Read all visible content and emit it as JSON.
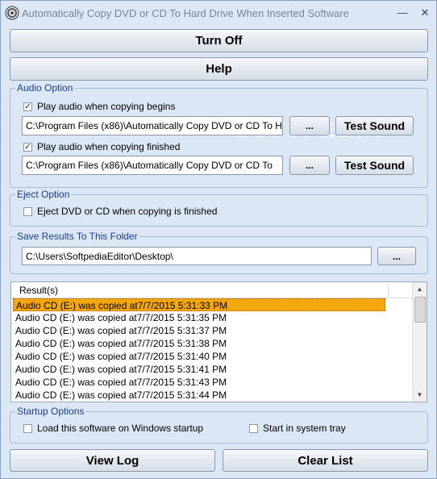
{
  "window": {
    "title": "Automatically Copy DVD or CD To Hard Drive When Inserted Software",
    "minimize": "—",
    "close": "✕"
  },
  "buttons": {
    "turn_off": "Turn Off",
    "help": "Help",
    "browse": "...",
    "test_sound": "Test Sound",
    "view_log": "View Log",
    "clear_list": "Clear List"
  },
  "audio_option": {
    "legend": "Audio Option",
    "begin_check_label": "Play audio when copying begins",
    "begin_checked": true,
    "begin_path": "C:\\Program Files (x86)\\Automatically Copy DVD or CD To H",
    "finish_check_label": "Play audio when copying finished",
    "finish_checked": true,
    "finish_path": "C:\\Program Files (x86)\\Automatically Copy DVD or CD To"
  },
  "eject_option": {
    "legend": "Eject Option",
    "check_label": "Eject DVD or CD when copying is finished",
    "checked": false
  },
  "save_results": {
    "legend": "Save Results To This Folder",
    "path": "C:\\Users\\SoftpediaEditor\\Desktop\\"
  },
  "results": {
    "header": "Result(s)",
    "rows": [
      "Audio CD (E:) was copied at7/7/2015 5:31:33 PM",
      "Audio CD (E:) was copied at7/7/2015 5:31:35 PM",
      "Audio CD (E:) was copied at7/7/2015 5:31:37 PM",
      "Audio CD (E:) was copied at7/7/2015 5:31:38 PM",
      "Audio CD (E:) was copied at7/7/2015 5:31:40 PM",
      "Audio CD (E:) was copied at7/7/2015 5:31:41 PM",
      "Audio CD (E:) was copied at7/7/2015 5:31:43 PM",
      "Audio CD (E:) was copied at7/7/2015 5:31:44 PM"
    ],
    "selected_index": 0
  },
  "startup_options": {
    "legend": "Startup Options",
    "load_on_startup_label": "Load this software on Windows startup",
    "load_on_startup_checked": false,
    "system_tray_label": "Start in system tray",
    "system_tray_checked": false
  },
  "watermark": "SOFTPEDIA"
}
